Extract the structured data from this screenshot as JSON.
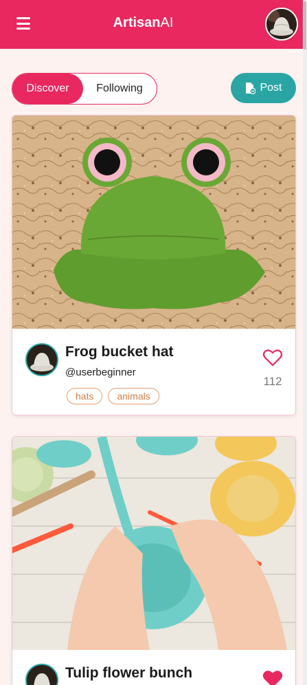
{
  "app": {
    "brand_bold": "Artisan",
    "brand_light": "AI"
  },
  "tabs": {
    "discover": "Discover",
    "following": "Following"
  },
  "post_button": "Post",
  "posts": [
    {
      "title": "Frog bucket hat",
      "user": "@userbeginner",
      "tags": [
        "hats",
        "animals"
      ],
      "likes": "112",
      "liked": false
    },
    {
      "title": "Tulip flower bunch",
      "liked": true
    }
  ],
  "colors": {
    "primary": "#e8285f",
    "accent": "#2aa5a4",
    "tag": "#d0804a"
  }
}
